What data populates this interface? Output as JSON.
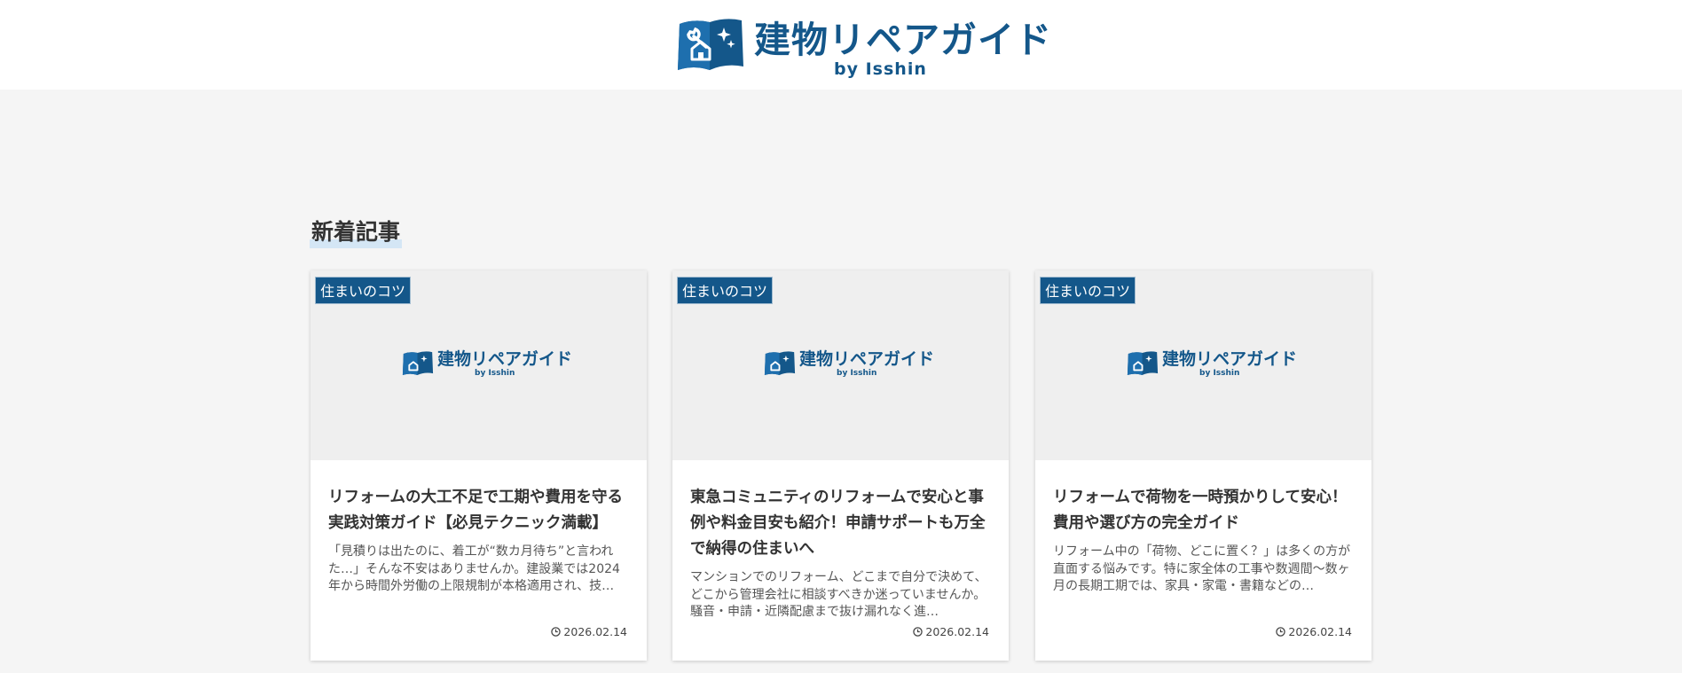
{
  "header": {
    "logo_title": "建物リペアガイド",
    "logo_byline": "by Isshin"
  },
  "section": {
    "heading": "新着記事"
  },
  "posts": [
    {
      "category": "住まいのコツ",
      "thumb_title": "建物リペアガイド",
      "thumb_byline": "by Isshin",
      "title": "リフォームの大工不足で工期や費用を守る実践対策ガイド【必見テクニック満載】",
      "excerpt": "「見積りは出たのに、着工が“数カ月待ち”と言われた…」そんな不安はありませんか。建設業では2024年から時間外労働の上限規制が本格適用され、技…",
      "date": "2026.02.14"
    },
    {
      "category": "住まいのコツ",
      "thumb_title": "建物リペアガイド",
      "thumb_byline": "by Isshin",
      "title": "東急コミュニティのリフォームで安心と事例や料金目安も紹介！申請サポートも万全で納得の住まいへ",
      "excerpt": "マンションでのリフォーム、どこまで自分で決めて、どこから管理会社に相談すべきか迷っていませんか。騒音・申請・近隣配慮まで抜け漏れなく進…",
      "date": "2026.02.14"
    },
    {
      "category": "住まいのコツ",
      "thumb_title": "建物リペアガイド",
      "thumb_byline": "by Isshin",
      "title": "リフォームで荷物を一時預かりして安心！費用や選び方の完全ガイド",
      "excerpt": "リフォーム中の「荷物、どこに置く？」は多くの方が直面する悩みです。特に家全体の工事や数週間〜数ヶ月の長期工期では、家具・家電・書籍などの…",
      "date": "2026.02.14"
    }
  ],
  "icons": {
    "logo_mark": "house-wrench-book-logo-icon",
    "date": "clock-icon"
  },
  "colors": {
    "brand": "#14578a",
    "page_bg": "#f5f5f5",
    "thumb_bg": "#efefef"
  }
}
